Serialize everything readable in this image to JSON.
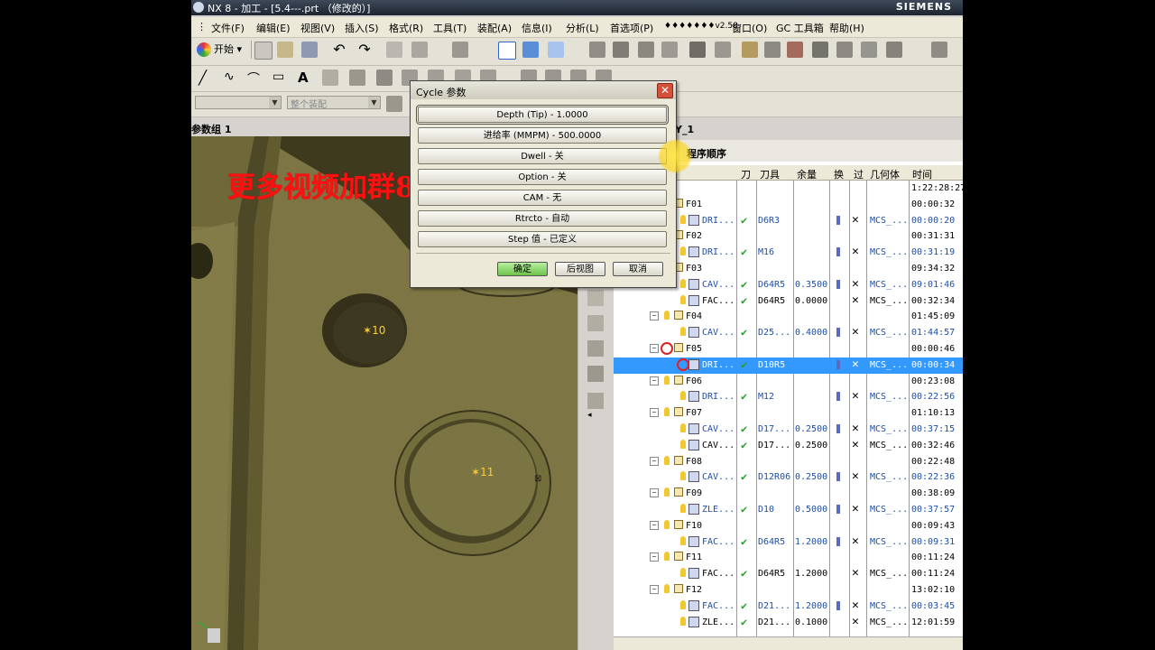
{
  "window": {
    "title": "NX 8 - 加工 - [5.4---.prt （修改的）]",
    "brand": "SIEMENS"
  },
  "menu": [
    "文件(F)",
    "编辑(E)",
    "视图(V)",
    "插入(S)",
    "格式(R)",
    "工具(T)",
    "装配(A)",
    "信息(I)",
    "分析(L)",
    "首选项(P)",
    "♦♦♦♦♦♦♦v2.58",
    "窗口(O)",
    "GC 工具箱",
    "帮助(H)"
  ],
  "toolbar": {
    "start_label": "开始",
    "filter_combo": "",
    "selection_combo": "整个装配"
  },
  "left_panel": {
    "title": "参数组 1"
  },
  "viewport": {
    "hole_labels": [
      "10",
      "11"
    ]
  },
  "navigator": {
    "header_suffix": "Y_1",
    "view_title": "程序顺序",
    "columns": [
      "刀",
      "刀具",
      "余量",
      "换",
      "过",
      "几何体",
      "时间"
    ],
    "rows": [
      {
        "kind": "root",
        "name": "",
        "time": "1:22:28:27"
      },
      {
        "kind": "group",
        "name": "F01",
        "time": "00:00:32"
      },
      {
        "kind": "op",
        "name": "DRI...",
        "tool": "D6R3",
        "stock": "",
        "tc": true,
        "x": true,
        "geom": "MCS_...",
        "time": "00:00:20"
      },
      {
        "kind": "group",
        "name": "F02",
        "time": "00:31:31"
      },
      {
        "kind": "op",
        "name": "DRI...",
        "tool": "M16",
        "stock": "",
        "tc": true,
        "x": true,
        "geom": "MCS_...",
        "time": "00:31:19"
      },
      {
        "kind": "group",
        "name": "F03",
        "time": "09:34:32"
      },
      {
        "kind": "op",
        "name": "CAV...",
        "tool": "D64R5",
        "stock": "0.3500",
        "tc": true,
        "x": true,
        "geom": "MCS_...",
        "time": "09:01:46"
      },
      {
        "kind": "op",
        "name": "FAC...",
        "tool": "D64R5",
        "stock": "0.0000",
        "tc": false,
        "x": true,
        "geom": "MCS_...",
        "time": "00:32:34",
        "plain": true
      },
      {
        "kind": "group",
        "name": "F04",
        "time": "01:45:09"
      },
      {
        "kind": "op",
        "name": "CAV...",
        "tool": "D25...",
        "stock": "0.4000",
        "tc": true,
        "x": true,
        "geom": "MCS_...",
        "time": "01:44:57"
      },
      {
        "kind": "group",
        "name": "F05",
        "time": "00:00:46",
        "no": true
      },
      {
        "kind": "op",
        "name": "DRI...",
        "tool": "D10R5",
        "stock": "",
        "tc": true,
        "x": true,
        "geom": "MCS_...",
        "time": "00:00:34",
        "selected": true,
        "no": true
      },
      {
        "kind": "group",
        "name": "F06",
        "time": "00:23:08"
      },
      {
        "kind": "op",
        "name": "DRI...",
        "tool": "M12",
        "stock": "",
        "tc": true,
        "x": true,
        "geom": "MCS_...",
        "time": "00:22:56"
      },
      {
        "kind": "group",
        "name": "F07",
        "time": "01:10:13"
      },
      {
        "kind": "op",
        "name": "CAV...",
        "tool": "D17...",
        "stock": "0.2500",
        "tc": true,
        "x": true,
        "geom": "MCS_...",
        "time": "00:37:15"
      },
      {
        "kind": "op",
        "name": "CAV...",
        "tool": "D17...",
        "stock": "0.2500",
        "tc": false,
        "x": true,
        "geom": "MCS_...",
        "time": "00:32:46",
        "plain": true
      },
      {
        "kind": "group",
        "name": "F08",
        "time": "00:22:48"
      },
      {
        "kind": "op",
        "name": "CAV...",
        "tool": "D12R06",
        "stock": "0.2500",
        "tc": true,
        "x": true,
        "geom": "MCS_...",
        "time": "00:22:36"
      },
      {
        "kind": "group",
        "name": "F09",
        "time": "00:38:09"
      },
      {
        "kind": "op",
        "name": "ZLE...",
        "tool": "D10",
        "stock": "0.5000",
        "tc": true,
        "x": true,
        "geom": "MCS_...",
        "time": "00:37:57"
      },
      {
        "kind": "group",
        "name": "F10",
        "time": "00:09:43"
      },
      {
        "kind": "op",
        "name": "FAC...",
        "tool": "D64R5",
        "stock": "1.2000",
        "tc": true,
        "x": true,
        "geom": "MCS_...",
        "time": "00:09:31"
      },
      {
        "kind": "group",
        "name": "F11",
        "time": "00:11:24"
      },
      {
        "kind": "op",
        "name": "FAC...",
        "tool": "D64R5",
        "stock": "1.2000",
        "tc": false,
        "x": true,
        "geom": "MCS_...",
        "time": "00:11:24",
        "plain": true
      },
      {
        "kind": "group",
        "name": "F12",
        "time": "13:02:10"
      },
      {
        "kind": "op",
        "name": "FAC...",
        "tool": "D21...",
        "stock": "1.2000",
        "tc": true,
        "x": true,
        "geom": "MCS_...",
        "time": "00:03:45"
      },
      {
        "kind": "op",
        "name": "ZLE...",
        "tool": "D21...",
        "stock": "0.1000",
        "tc": false,
        "x": true,
        "geom": "MCS_...",
        "time": "12:01:59",
        "plain": true
      }
    ]
  },
  "dialog": {
    "title": "Cycle 参数",
    "buttons": [
      "Depth (Tip) - 1.0000",
      "进给率 (MMPM) - 500.0000",
      "Dwell - 关",
      "Option - 关",
      "CAM - 无",
      "Rtrcto - 自动",
      "Step 值 - 已定义"
    ],
    "ok": "确定",
    "back": "后视图",
    "cancel": "取消"
  },
  "watermark": "更多视频加群855679380领取",
  "colors": {
    "part_face": "#7d7644",
    "selection_blue": "#3399ff",
    "watermark_red": "#ff1010"
  }
}
